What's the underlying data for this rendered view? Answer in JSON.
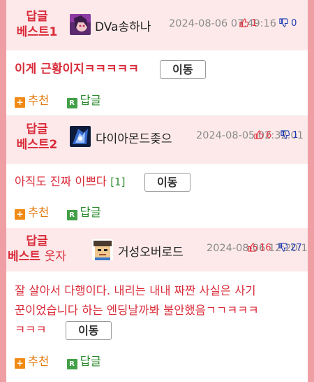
{
  "comments": [
    {
      "badge_line1": "답글",
      "badge_line2": "베스트1",
      "nickname": "DVa송하나",
      "date": "2024-08-06 07:49:16",
      "up_count": "1",
      "down_count": "0",
      "text": "이게 근황이지ㅋㅋㅋㅋㅋ",
      "reply_count": "",
      "move_label": "이동",
      "recommend_label": "추천",
      "reply_label": "답글"
    },
    {
      "badge_line1": "답글",
      "badge_line2": "베스트2",
      "nickname": "다이아몬드좆으",
      "date": "2024-08-05 02:32:01",
      "up_count": "6",
      "down_count": "1",
      "text": "아직도 진짜 이쁘다",
      "reply_count": "[1]",
      "move_label": "이동",
      "recommend_label": "추천",
      "reply_label": "답글"
    },
    {
      "badge_line1": "답글",
      "badge_line2_a": "베스트",
      "badge_line2_b": "웃자",
      "nickname": "거성오버로드",
      "date": "2024-08-06 12:20:19",
      "up_count": "16",
      "down_count": "27",
      "text": "잘 살아서 다행이다. 내리는 내내 짜짠 사실은 사기꾼이었습니다 하는 엔딩날까봐 불안했음ㄱㄱㅋㅋㅋㅋㅋㅋ",
      "text_line1": "잘 살아서 다행이다. 내리는 내내 짜짠 사실은 사기",
      "text_line2": "꾼이었습니다 하는 엔딩날까봐 불안했음ㄱㄱㅋㅋㅋ",
      "text_line3": "ㅋㅋㅋ",
      "move_label": "이동",
      "recommend_label": "추천",
      "reply_label": "답글"
    }
  ],
  "colors": {
    "accent_red": "#d92c3a",
    "recommend_orange": "#e37a0f",
    "reply_green": "#2e8b2e",
    "down_blue": "#1d3db5",
    "header_pink": "#fde9ea",
    "frame_pink": "#ef9ea4"
  },
  "icons": {
    "recommend": "plus-square-icon",
    "reply": "r-square-icon",
    "up": "thumb-up-icon",
    "down": "thumb-down-icon"
  }
}
